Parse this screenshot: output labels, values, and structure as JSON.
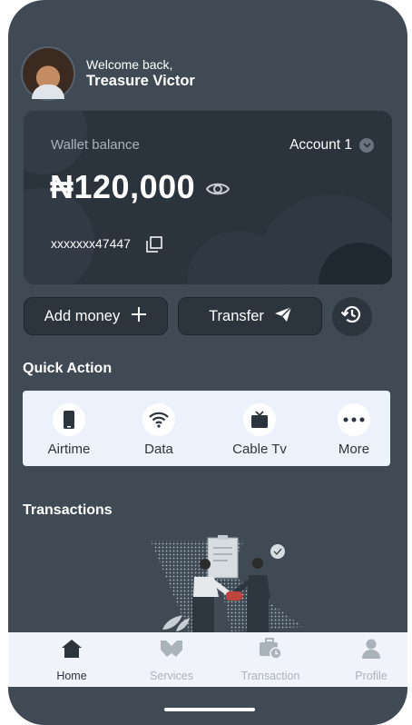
{
  "header": {
    "welcome": "Welcome back,",
    "name": "Treasure Victor"
  },
  "wallet": {
    "label": "Wallet balance",
    "account_label": "Account 1",
    "balance": "₦120,000",
    "account_number": "xxxxxxx47447"
  },
  "actions": {
    "add_money": "Add money",
    "transfer": "Transfer"
  },
  "quick_action": {
    "title": "Quick Action",
    "items": [
      {
        "label": "Airtime",
        "icon": "phone-icon"
      },
      {
        "label": "Data",
        "icon": "wifi-icon"
      },
      {
        "label": "Cable Tv",
        "icon": "tv-icon"
      },
      {
        "label": "More",
        "icon": "more-icon"
      }
    ]
  },
  "transactions": {
    "title": "Transactions"
  },
  "tabbar": {
    "items": [
      {
        "label": "Home",
        "icon": "home-icon",
        "active": true
      },
      {
        "label": "Services",
        "icon": "services-icon",
        "active": false
      },
      {
        "label": "Transaction",
        "icon": "transaction-icon",
        "active": false
      },
      {
        "label": "Profile",
        "icon": "profile-icon",
        "active": false
      }
    ]
  },
  "colors": {
    "background": "#3f4a55",
    "card": "#2b333d",
    "panel": "#edf1fb",
    "tab_active": "#2c343e",
    "tab_inactive": "#aab2bb"
  }
}
